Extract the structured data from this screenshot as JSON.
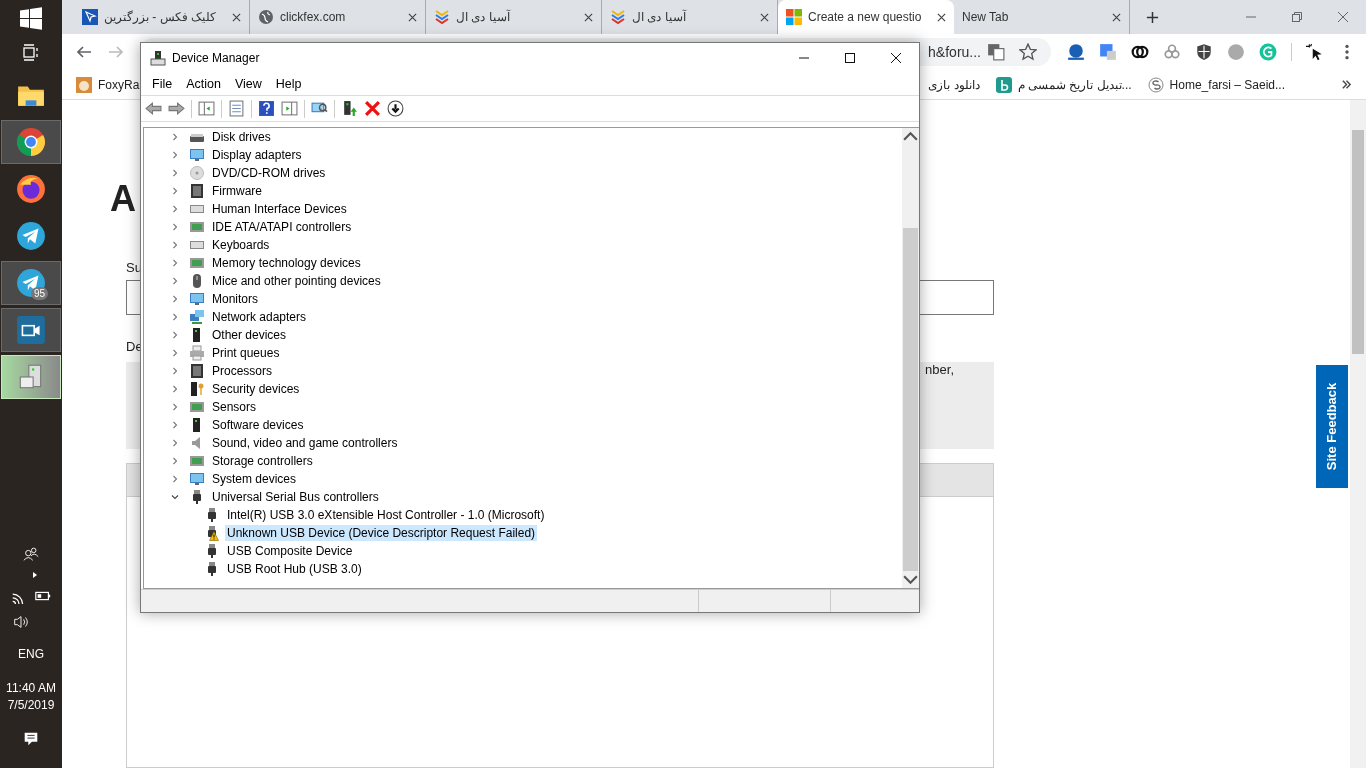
{
  "taskbar": {
    "items": [
      {
        "kind": "folder",
        "running": false,
        "selected": false
      },
      {
        "kind": "chrome",
        "running": true,
        "selected": false
      },
      {
        "kind": "firefox",
        "running": false,
        "selected": false
      },
      {
        "kind": "telegram",
        "running": false,
        "selected": false
      },
      {
        "kind": "telegram",
        "running": true,
        "selected": false,
        "badge": "95"
      },
      {
        "kind": "video",
        "running": true,
        "selected": false
      },
      {
        "kind": "device",
        "running": true,
        "selected": true
      }
    ],
    "tray": {
      "language": "ENG",
      "time": "11:40 AM",
      "date": "7/5/2019"
    }
  },
  "browser": {
    "tabs": [
      {
        "title": "کلیک فکس - بزرگترین",
        "selected": false
      },
      {
        "title": "clickfex.com",
        "selected": false
      },
      {
        "title": "آسیا دی ال",
        "selected": false
      },
      {
        "title": "آسیا دی ال",
        "selected": false
      },
      {
        "title": "Create a new questio",
        "selected": true
      },
      {
        "title": "New Tab",
        "selected": false
      }
    ],
    "address": {
      "value": "h&foru..."
    },
    "bookmarks": [
      {
        "label": "FoxyRa"
      },
      {
        "label": "دانلود بازی"
      },
      {
        "label": "تبدیل تاریخ شمسی م..."
      },
      {
        "label": "Home_farsi – Saeid..."
      }
    ]
  },
  "page": {
    "heading": "A",
    "field_label": "Su",
    "description_label": "De",
    "notice_text": "nber,",
    "feedback_tab": "Site Feedback"
  },
  "device_manager": {
    "title": "Device Manager",
    "menu": [
      "File",
      "Action",
      "View",
      "Help"
    ],
    "tree": [
      {
        "label": "Disk drives",
        "expanded": false,
        "selected": false
      },
      {
        "label": "Display adapters",
        "expanded": false,
        "selected": false
      },
      {
        "label": "DVD/CD-ROM drives",
        "expanded": false,
        "selected": false
      },
      {
        "label": "Firmware",
        "expanded": false,
        "selected": false
      },
      {
        "label": "Human Interface Devices",
        "expanded": false,
        "selected": false
      },
      {
        "label": "IDE ATA/ATAPI controllers",
        "expanded": false,
        "selected": false
      },
      {
        "label": "Keyboards",
        "expanded": false,
        "selected": false
      },
      {
        "label": "Memory technology devices",
        "expanded": false,
        "selected": false
      },
      {
        "label": "Mice and other pointing devices",
        "expanded": false,
        "selected": false
      },
      {
        "label": "Monitors",
        "expanded": false,
        "selected": false
      },
      {
        "label": "Network adapters",
        "expanded": false,
        "selected": false
      },
      {
        "label": "Other devices",
        "expanded": false,
        "selected": false
      },
      {
        "label": "Print queues",
        "expanded": false,
        "selected": false
      },
      {
        "label": "Processors",
        "expanded": false,
        "selected": false
      },
      {
        "label": "Security devices",
        "expanded": false,
        "selected": false
      },
      {
        "label": "Sensors",
        "expanded": false,
        "selected": false
      },
      {
        "label": "Software devices",
        "expanded": false,
        "selected": false
      },
      {
        "label": "Sound, video and game controllers",
        "expanded": false,
        "selected": false
      },
      {
        "label": "Storage controllers",
        "expanded": false,
        "selected": false
      },
      {
        "label": "System devices",
        "expanded": false,
        "selected": false
      },
      {
        "label": "Universal Serial Bus controllers",
        "expanded": true,
        "selected": false,
        "children": [
          {
            "label": "Intel(R) USB 3.0 eXtensible Host Controller - 1.0 (Microsoft)",
            "selected": false,
            "warning": false
          },
          {
            "label": "Unknown USB Device (Device Descriptor Request Failed)",
            "selected": true,
            "warning": true
          },
          {
            "label": "USB Composite Device",
            "selected": false,
            "warning": false
          },
          {
            "label": "USB Root Hub (USB 3.0)",
            "selected": false,
            "warning": false
          }
        ]
      }
    ]
  }
}
